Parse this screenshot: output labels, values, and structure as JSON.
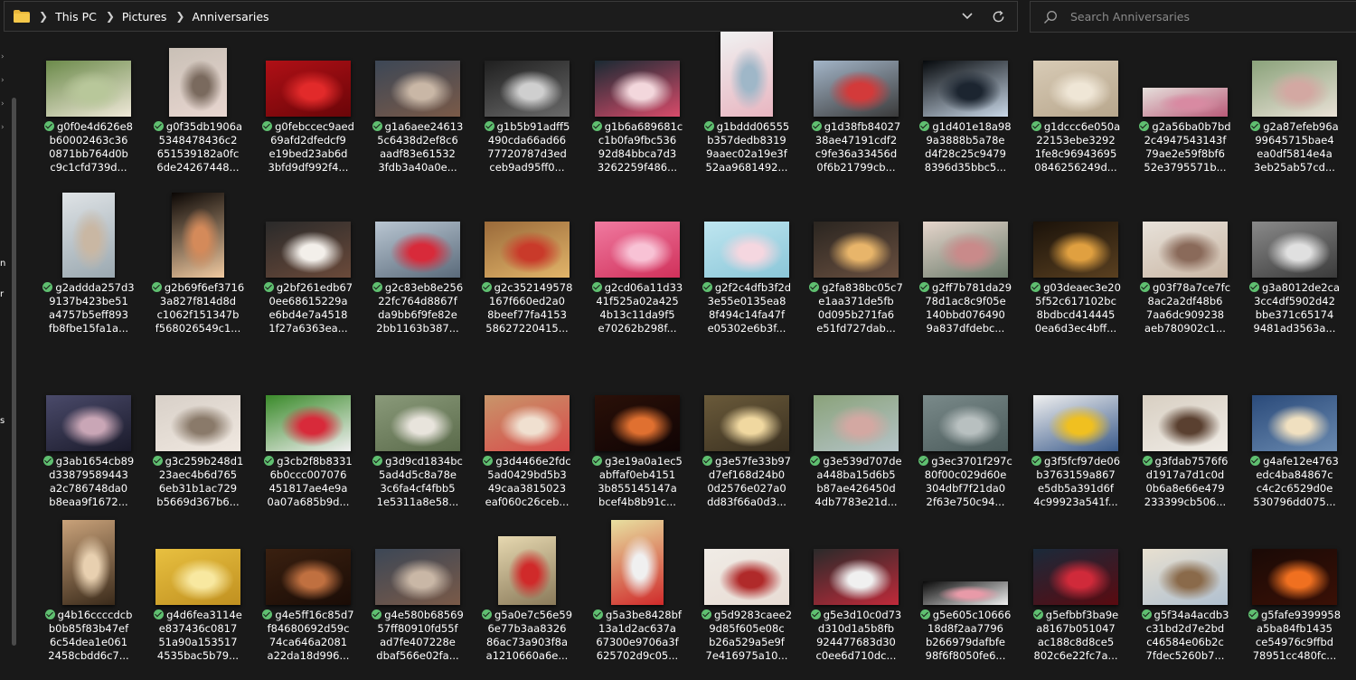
{
  "address": {
    "crumbs": [
      "This PC",
      "Pictures",
      "Anniversaries"
    ]
  },
  "search": {
    "placeholder": "Search Anniversaries"
  },
  "nav_peek": [
    "n",
    "r",
    "s"
  ],
  "items": [
    {
      "lines": [
        "g0f0e4d626e8",
        "b60002463c36",
        "0871bb764d0b",
        "c9c1cfd739d..."
      ],
      "colors": [
        "#6b8a4a",
        "#b8c79a",
        "#efe8d8"
      ],
      "ratio": "wide"
    },
    {
      "lines": [
        "g0f35db1906a",
        "5348478436c2",
        "651539182a0fc",
        "6de24267448..."
      ],
      "colors": [
        "#c9c0b6",
        "#7a6a5e",
        "#e8d6d0"
      ],
      "ratio": "square"
    },
    {
      "lines": [
        "g0febccec9aed",
        "69afd2dfedcf9",
        "e19bed23ab6d",
        "3bfd9df992f4..."
      ],
      "colors": [
        "#b01016",
        "#e22a2a",
        "#6a0508"
      ],
      "ratio": "wide"
    },
    {
      "lines": [
        "g1a6aee24613",
        "5c6438d2ef8c6",
        "aadf83e61532",
        "3fdb3a40a0e..."
      ],
      "colors": [
        "#3c4756",
        "#c9b7a6",
        "#7a5a48"
      ],
      "ratio": "wide"
    },
    {
      "lines": [
        "g1b5b91adff5",
        "490cda66ad66",
        "77720787d3ed",
        "ceb9ad95ff0..."
      ],
      "colors": [
        "#1f1f1f",
        "#cfcfcf",
        "#6a6a6a"
      ],
      "ratio": "wide"
    },
    {
      "lines": [
        "g1b6a689681c",
        "c1b0fa9fbc536",
        "92d84bbca7d3",
        "3262259f486..."
      ],
      "colors": [
        "#1a2a33",
        "#f3d7dc",
        "#d84b6a"
      ],
      "ratio": "wide"
    },
    {
      "lines": [
        "g1bddd06555",
        "b357dedb8319",
        "9aaec02a19e3f",
        "52aa9681492..."
      ],
      "colors": [
        "#f0f2f2",
        "#9fb7c8",
        "#e8b5c0"
      ],
      "ratio": "tall"
    },
    {
      "lines": [
        "g1d38fb84027",
        "38ae47191cdf2",
        "c9fe36a33456d",
        "0f6b21799cb..."
      ],
      "colors": [
        "#a3b5c8",
        "#d33a3a",
        "#3a3a3a"
      ],
      "ratio": "wide"
    },
    {
      "lines": [
        "g1d401e18a98",
        "9a3888b5a78e",
        "d4f28c25c9479",
        "8396d35bbc5..."
      ],
      "colors": [
        "#06090c",
        "#1c2530",
        "#c9d8e8"
      ],
      "ratio": "wide"
    },
    {
      "lines": [
        "g1dccc6e050a",
        "22153ebe3292",
        "1fe8c96943695",
        "0846256249d..."
      ],
      "colors": [
        "#d8cbb6",
        "#efe6d6",
        "#b7a68c"
      ],
      "ratio": "wide"
    },
    {
      "lines": [
        "g2a56ba0b7bd",
        "2c4947543143f",
        "79ae2e59f8bf6",
        "52e3795571b..."
      ],
      "colors": [
        "#e6e0dc",
        "#d88aa2",
        "#b95a78"
      ],
      "ratio": "banner"
    },
    {
      "lines": [
        "g2a87efeb96a",
        "99645715bae4",
        "ea0df5814e4a",
        "3eb25ab57cd..."
      ],
      "colors": [
        "#8aa27a",
        "#d3a8a2",
        "#e9e1d6"
      ],
      "ratio": "wide"
    },
    {
      "lines": [
        "g2addda257d3",
        "9137b423be51",
        "a4757b5eff893",
        "fb8fbe15fa1a..."
      ],
      "colors": [
        "#dfe3e6",
        "#c9b7a3",
        "#9aa8b0"
      ],
      "ratio": "tall"
    },
    {
      "lines": [
        "g2b69f6ef3716",
        "3a827f814d8d",
        "c1062f151347b",
        "f568026549c1..."
      ],
      "colors": [
        "#0a0604",
        "#d48a5a",
        "#f0c9a0"
      ],
      "ratio": "tall"
    },
    {
      "lines": [
        "g2bf261edb67",
        "0ee68615229a",
        "e6bd4e7a4518",
        "1f27a6363ea..."
      ],
      "colors": [
        "#2a2a2a",
        "#f3efea",
        "#6b4a3a"
      ],
      "ratio": "wide"
    },
    {
      "lines": [
        "g2c83eb8e256",
        "22fc764d8867f",
        "da9bb6f9fe82e",
        "2bb1163b387..."
      ],
      "colors": [
        "#b9c6d2",
        "#d82a3a",
        "#5a6a7a"
      ],
      "ratio": "wide"
    },
    {
      "lines": [
        "g2c352149578",
        "167f660ed2a0",
        "8beef77fa4153",
        "58627220415..."
      ],
      "colors": [
        "#9a6a3a",
        "#c93a2a",
        "#e2b56a"
      ],
      "ratio": "wide"
    },
    {
      "lines": [
        "g2cd06a11d33",
        "41f525a02a425",
        "4b13c11da9f5",
        "e70262b298f..."
      ],
      "colors": [
        "#f07aa0",
        "#f8c2d5",
        "#d0305a"
      ],
      "ratio": "wide"
    },
    {
      "lines": [
        "g2f2c4dfb3f2d",
        "3e55e0135ea8",
        "8f494c14fa47f",
        "e05302e6b3f..."
      ],
      "colors": [
        "#bfe6f0",
        "#f5d7e0",
        "#8ac6d8"
      ],
      "ratio": "wide"
    },
    {
      "lines": [
        "g2fa838bc05c7",
        "e1aa371de5fb",
        "0d095b271fa6",
        "e51fd727dab..."
      ],
      "colors": [
        "#2a2520",
        "#e8b56a",
        "#6a5040"
      ],
      "ratio": "wide"
    },
    {
      "lines": [
        "g2ff7b781da29",
        "78d1ac8c9f05e",
        "140bbd076490",
        "9a837dfdebc..."
      ],
      "colors": [
        "#e6d6cc",
        "#c98a8a",
        "#6a7a6a"
      ],
      "ratio": "wide"
    },
    {
      "lines": [
        "g03deaec3e20",
        "5f52c617102bc",
        "8bdbcd414445",
        "0ea6d3ec4bff..."
      ],
      "colors": [
        "#1a120a",
        "#e0a040",
        "#5a4020"
      ],
      "ratio": "wide"
    },
    {
      "lines": [
        "g03f78a7ce7fc",
        "8ac2a2df48b6",
        "7aa6dc909238",
        "aeb780902c1..."
      ],
      "colors": [
        "#e8e2da",
        "#8a6a5a",
        "#c9b6a4"
      ],
      "ratio": "wide"
    },
    {
      "lines": [
        "g3a8012de2ca",
        "3cc4df5902d42",
        "bbe371c65174",
        "9481ad3563a..."
      ],
      "colors": [
        "#8a8a8a",
        "#e0e0e0",
        "#3a3a3a"
      ],
      "ratio": "wide"
    },
    {
      "lines": [
        "g3ab1654cb89",
        "d33879589443",
        "a2c786748da0",
        "b8eaa9f1672..."
      ],
      "colors": [
        "#4a4a6a",
        "#c9a6b6",
        "#1a1a2a"
      ],
      "ratio": "wide"
    },
    {
      "lines": [
        "g3c259b248d1",
        "23aec4b6d765",
        "6eb31b1ac729",
        "b5669d367b6..."
      ],
      "colors": [
        "#d8d0c8",
        "#8a7a6a",
        "#f0e8e0"
      ],
      "ratio": "wide"
    },
    {
      "lines": [
        "g3cb2f8b8331",
        "6b0ccc007076",
        "451817ae4e9a",
        "0a07a685b9d..."
      ],
      "colors": [
        "#3a8a2a",
        "#d82a3a",
        "#f0f0f0"
      ],
      "ratio": "wide"
    },
    {
      "lines": [
        "g3d9cd1834bc",
        "5ad4d5c8a78e",
        "3c6fa4cf4fbb5",
        "1e5311a8e58..."
      ],
      "colors": [
        "#8a9a7a",
        "#e8e4dc",
        "#5a6a4a"
      ],
      "ratio": "wide"
    },
    {
      "lines": [
        "g3d4466e2fdc",
        "5ad0429bd5b3",
        "49caa3815023",
        "eaf060c26ceb..."
      ],
      "colors": [
        "#c8956a",
        "#f0e0d0",
        "#d84a4a"
      ],
      "ratio": "wide"
    },
    {
      "lines": [
        "g3e19a0a1ec5",
        "abffaf0eb4151",
        "3b855145147a",
        "bcef4b8b91c..."
      ],
      "colors": [
        "#2a1008",
        "#e07030",
        "#100404"
      ],
      "ratio": "wide"
    },
    {
      "lines": [
        "g3e57fe33b97",
        "d7ef168d24b0",
        "0d2576e027a0",
        "dd83f66a0d3..."
      ],
      "colors": [
        "#6a5a3a",
        "#f0d8a0",
        "#3a3020"
      ],
      "ratio": "wide"
    },
    {
      "lines": [
        "g3e539d707de",
        "a448ba15d6b5",
        "b87ae426450d",
        "4db7783e21d..."
      ],
      "colors": [
        "#8aa27a",
        "#d3a8a2",
        "#b5c4c8"
      ],
      "ratio": "wide"
    },
    {
      "lines": [
        "g3ec3701f297c",
        "80f00c029d60e",
        "304dbf7f21da0",
        "2f63e750c94..."
      ],
      "colors": [
        "#7a8a8a",
        "#b8c0c0",
        "#4a5a5a"
      ],
      "ratio": "wide"
    },
    {
      "lines": [
        "g3f5fcf97de06",
        "b3763159a867",
        "e5db5a391d6f",
        "4c99923a541f..."
      ],
      "colors": [
        "#f0f0f0",
        "#f0c020",
        "#3a5a8a"
      ],
      "ratio": "wide"
    },
    {
      "lines": [
        "g3fdab7576f6",
        "d1917a7d1c0d",
        "0b6a8e66e479",
        "233399cb506..."
      ],
      "colors": [
        "#d8cfc2",
        "#5a4030",
        "#f0ece6"
      ],
      "ratio": "wide"
    },
    {
      "lines": [
        "g4afe12e4763",
        "edc4ba84867c",
        "c4c2c6529d0e",
        "530796dd075..."
      ],
      "colors": [
        "#2a4a7a",
        "#f0e0c0",
        "#6a8ab0"
      ],
      "ratio": "wide"
    },
    {
      "lines": [
        "g4b16ccccdcb",
        "b0b85f83b47ef",
        "6c54dea1e061",
        "2458cbdd6c7..."
      ],
      "colors": [
        "#c9a27a",
        "#e8d0b0",
        "#3a2a1a"
      ],
      "ratio": "tall"
    },
    {
      "lines": [
        "g4d6fea3114e",
        "e837436c0817",
        "51a90a153517",
        "4535bac5b79..."
      ],
      "colors": [
        "#e8c040",
        "#f8e8a0",
        "#c09020"
      ],
      "ratio": "wide"
    },
    {
      "lines": [
        "g4e5ff16c85d7",
        "f84680692d59c",
        "74ca646a2081",
        "a22da18d996..."
      ],
      "colors": [
        "#3a2010",
        "#c07040",
        "#1a0c06"
      ],
      "ratio": "wide"
    },
    {
      "lines": [
        "g4e580b68569",
        "57ff80910fd55f",
        "ad7fe407228e",
        "dbaf566e02fa..."
      ],
      "colors": [
        "#3c4756",
        "#c9b7a6",
        "#7a5a48"
      ],
      "ratio": "wide"
    },
    {
      "lines": [
        "g5a0e7c56e59",
        "6e77b3aa8326",
        "86ac73a903f8a",
        "a1210660a6e..."
      ],
      "colors": [
        "#e6d8b0",
        "#d02a2a",
        "#8a7a5a"
      ],
      "ratio": "square"
    },
    {
      "lines": [
        "g5a3be8428bf",
        "13a1d2ac637a",
        "67300e9706a3f",
        "625702d9c05..."
      ],
      "colors": [
        "#e8e0a0",
        "#f0f0f0",
        "#d02a2a"
      ],
      "ratio": "tall"
    },
    {
      "lines": [
        "g5d9283caee2",
        "9d85f605e08c",
        "b26a529a5e9f",
        "7e416975a10..."
      ],
      "colors": [
        "#f0ece6",
        "#b02a2a",
        "#e8dcd4"
      ],
      "ratio": "wide"
    },
    {
      "lines": [
        "g5e3d10c0d73",
        "d310d1a5b8fb",
        "924477683d30",
        "c0ee6d710dc..."
      ],
      "colors": [
        "#2a2a2a",
        "#f0f0f0",
        "#c02a3a"
      ],
      "ratio": "wide"
    },
    {
      "lines": [
        "g5e605c10666",
        "18d8f2aa7796",
        "b266979dafbfe",
        "98f6f8050fe6..."
      ],
      "colors": [
        "#0a0a0a",
        "#e89aa8",
        "#f0f0f0"
      ],
      "ratio": "banner2"
    },
    {
      "lines": [
        "g5efbbf3ba9e",
        "a8167b051047",
        "ac188c8d8ce5",
        "802c6e22fc7a..."
      ],
      "colors": [
        "#1a2a3a",
        "#d02a3a",
        "#5a0a10"
      ],
      "ratio": "wide"
    },
    {
      "lines": [
        "g5f34a4acdb3",
        "c31bd2d7e2bd",
        "c46584e06b2c",
        "7fdec5260b7..."
      ],
      "colors": [
        "#e8e0d0",
        "#8a6a4a",
        "#b0c0d0"
      ],
      "ratio": "wide"
    },
    {
      "lines": [
        "g5fafe9399958",
        "a5ba84fb1435",
        "ce54976c9ffbd",
        "78951cc480fc..."
      ],
      "colors": [
        "#1a0a06",
        "#f07020",
        "#3a1006"
      ],
      "ratio": "wide"
    }
  ]
}
